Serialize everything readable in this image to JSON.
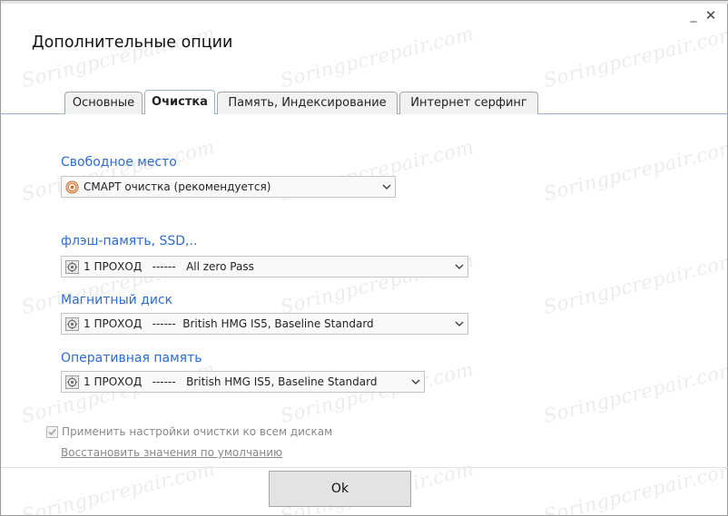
{
  "window": {
    "title": "Дополнительные опции",
    "minimize_glyph": "_",
    "close_glyph": "✕"
  },
  "watermark": "Soringpcrepair.com",
  "tabs": [
    {
      "label": "Основные",
      "active": false
    },
    {
      "label": "Очистка",
      "active": true
    },
    {
      "label": "Память, Индексирование",
      "active": false
    },
    {
      "label": "Интернет серфинг",
      "active": false
    }
  ],
  "sections": {
    "free_space": {
      "label": "Свободное место",
      "value": "СМАРТ очистка (рекомендуется)",
      "icon": "target-icon"
    },
    "flash": {
      "label": "флэш-память, SSD,..",
      "value": "1 ПРОХОД   ------   All zero Pass",
      "icon": "shredder-icon"
    },
    "magnetic": {
      "label": "Магнитный диск",
      "value": "1 ПРОХОД   ------  British HMG IS5, Baseline Standard",
      "icon": "shredder-icon"
    },
    "ram": {
      "label": "Оперативная память",
      "value": "1 ПРОХОД   ------   British HMG IS5, Baseline Standard",
      "icon": "shredder-icon"
    }
  },
  "apply_all": {
    "label": "Применить настройки очистки ко всем дискам",
    "checked": true
  },
  "restore_defaults": "Восстановить значения по умолчанию",
  "ok_button": "Ok",
  "colors": {
    "accent": "#2b6bd1",
    "tab_border": "#9ab3cc"
  }
}
